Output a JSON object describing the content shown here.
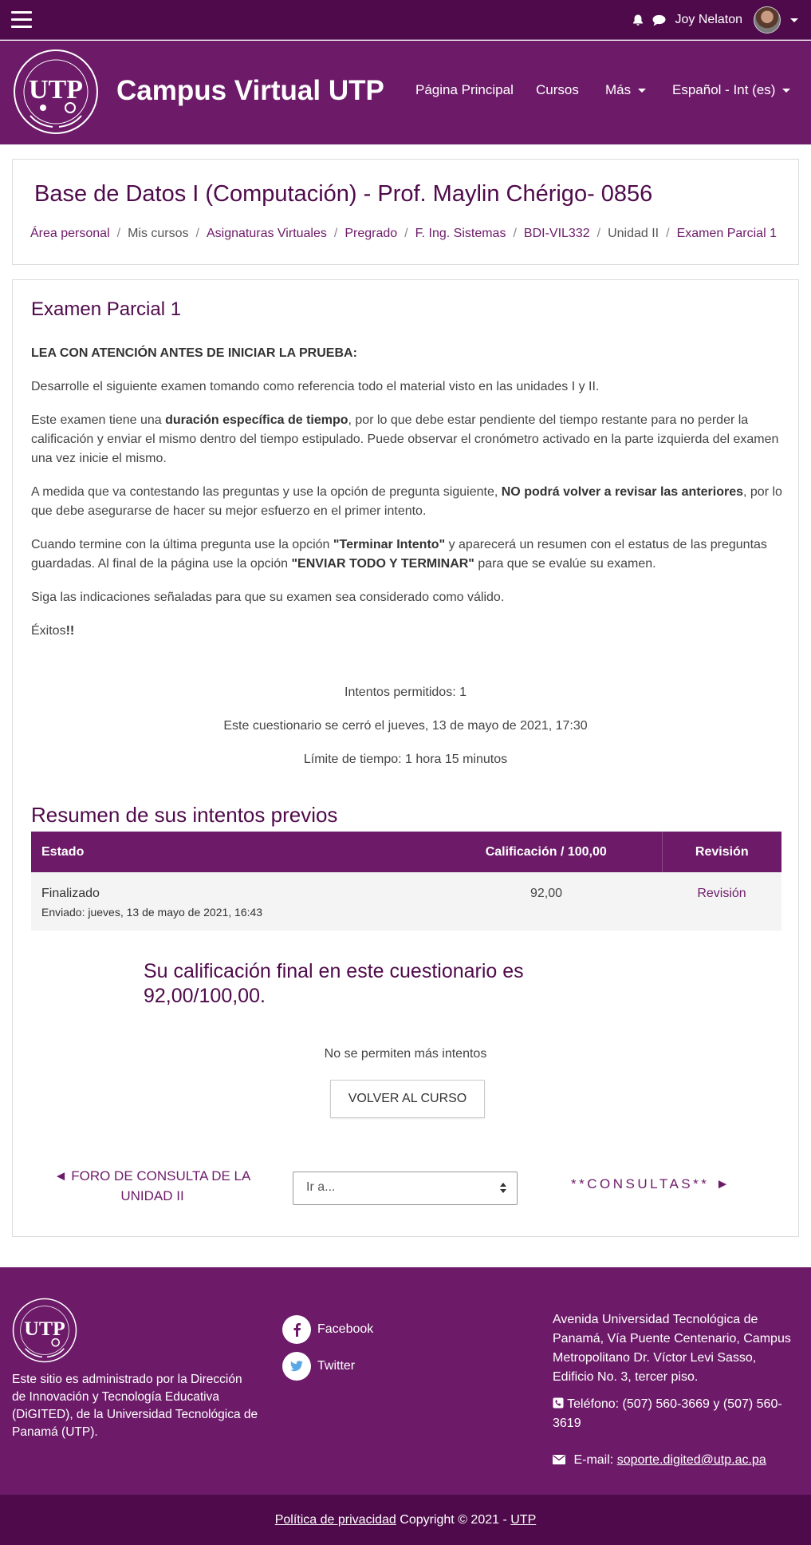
{
  "topbar": {
    "user_name": "Joy Nelaton"
  },
  "header": {
    "site_title": "Campus Virtual UTP",
    "nav": [
      "Página Principal",
      "Cursos",
      "Más",
      "Español - Int (es)"
    ]
  },
  "course": {
    "title": "Base de Datos I (Computación) - Prof. Maylin Chérigo- 0856",
    "breadcrumb": [
      "Área personal",
      "Mis cursos",
      "Asignaturas Virtuales",
      "Pregrado",
      "F. Ing. Sistemas",
      "BDI-VIL332",
      "Unidad II",
      "Examen Parcial 1"
    ]
  },
  "exam": {
    "title": "Examen Parcial 1",
    "heading": "LEA CON ATENCIÓN ANTES DE INICIAR LA PRUEBA:",
    "p1": "Desarrolle el siguiente examen tomando como referencia todo el material visto en las unidades I y II.",
    "p2_a": "Este examen tiene una ",
    "p2_b": "duración específica de tiempo",
    "p2_c": ", por lo que debe estar pendiente del tiempo restante para no perder la calificación y enviar el mismo dentro del tiempo estipulado. Puede observar el cronómetro activado en la parte izquierda del examen una vez inicie el mismo.",
    "p3_a": "A medida que va contestando las preguntas y use la opción de pregunta siguiente, ",
    "p3_b": "NO podrá volver a revisar las anteriores",
    "p3_c": ", por lo que debe asegurarse de hacer su mejor esfuerzo en el primer intento.",
    "p4_a": "Cuando termine con la última pregunta use la opción ",
    "p4_b": "\"Terminar Intento\"",
    "p4_c": " y aparecerá un resumen con el estatus de las preguntas guardadas. Al final de la página use la opción ",
    "p4_d": "\"ENVIAR TODO Y TERMINAR\"",
    "p4_e": " para que se evalúe su examen.",
    "p5": "Siga las indicaciones señaladas para que su examen sea considerado como válido.",
    "p6_a": "Éxitos",
    "p6_b": "!!",
    "attempts_allowed": "Intentos permitidos: 1",
    "closed": "Este cuestionario se cerró el jueves, 13 de mayo de 2021, 17:30",
    "time_limit": "Límite de tiempo: 1 hora 15 minutos"
  },
  "summary": {
    "title": "Resumen de sus intentos previos",
    "headers": [
      "Estado",
      "Calificación / 100,00",
      "Revisión"
    ],
    "row": {
      "status": "Finalizado",
      "submitted": "Enviado: jueves, 13 de mayo de 2021, 16:43",
      "grade": "92,00",
      "review": "Revisión"
    },
    "final_grade": "Su calificación final en este cuestionario es 92,00/100,00.",
    "no_more": "No se permiten más intentos",
    "back_button": "VOLVER AL CURSO"
  },
  "navigation": {
    "prev": "◄ FORO DE CONSULTA DE LA UNIDAD II",
    "jump_placeholder": "Ir a...",
    "next": "**CONSULTAS** ►"
  },
  "footer": {
    "about": "Este sitio es administrado por la Dirección de Innovación y Tecnología Educativa (DiGITED), de la Universidad Tecnológica de Panamá (UTP).",
    "facebook": "Facebook",
    "twitter": "Twitter",
    "address": "Avenida Universidad Tecnológica de Panamá, Vía Puente Centenario, Campus Metropolitano Dr. Víctor Levi Sasso, Edificio No. 3, tercer piso.",
    "phone": "Teléfono: (507) 560-3669 y (507) 560-3619",
    "email_label": "E-mail: ",
    "email": "soporte.digited@utp.ac.pa",
    "privacy": "Política de privacidad",
    "copyright": " Copyright © 2021 - ",
    "utp": "UTP"
  },
  "colors": {
    "primary": "#6d1b69",
    "dark": "#4f0a4b",
    "text": "#444444"
  },
  "icons": [
    "menu-icon",
    "bell-icon",
    "chat-icon",
    "facebook-icon",
    "twitter-icon",
    "phone-icon",
    "envelope-icon"
  ]
}
